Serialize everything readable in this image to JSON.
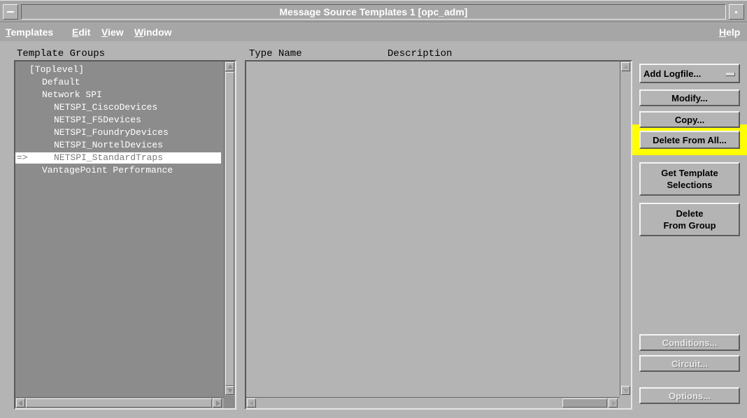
{
  "window": {
    "title": "Message Source Templates  1 [opc_adm]"
  },
  "menu": {
    "templates": "Templates",
    "edit": "Edit",
    "view": "View",
    "window": "Window",
    "help": "Help"
  },
  "template_groups": {
    "header": "Template Groups",
    "items": [
      {
        "label": "[Toplevel]"
      },
      {
        "label": "Default"
      },
      {
        "label": "Network SPI"
      },
      {
        "label": "NETSPI_CiscoDevices"
      },
      {
        "label": "NETSPI_F5Devices"
      },
      {
        "label": "NETSPI_FoundryDevices"
      },
      {
        "label": "NETSPI_NortelDevices"
      },
      {
        "label": "NETSPI_StandardTraps",
        "marker": "=>",
        "selected": true
      },
      {
        "label": "VantagePoint Performance"
      }
    ]
  },
  "template_list": {
    "col_type_name": "Type Name",
    "col_description": "Description"
  },
  "buttons": {
    "add_logfile": "Add Logfile...",
    "modify": "Modify...",
    "copy": "Copy...",
    "delete_from_all": "Delete From All...",
    "get_template_selections_1": "Get Template",
    "get_template_selections_2": "Selections",
    "delete_from_group_1": "Delete",
    "delete_from_group_2": "From Group",
    "conditions": "Conditions...",
    "circuit": "Circuit...",
    "options": "Options..."
  },
  "colors": {
    "highlight": "#ffff00",
    "selection_row": "#ffffff",
    "panel": "#8c8c8c",
    "background": "#b4b4b4"
  }
}
